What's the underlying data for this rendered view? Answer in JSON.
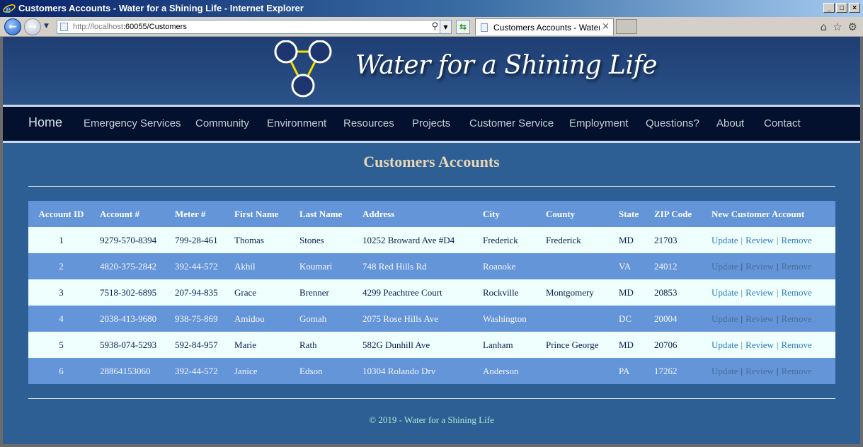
{
  "window": {
    "title": "Customers Accounts - Water for a Shining Life - Internet Explorer",
    "buttons": [
      "_",
      "□",
      "×"
    ]
  },
  "browser": {
    "url_host": "http://localhost",
    "url_rest": ":60055/Customers",
    "tab_label": "Customers Accounts - Water...",
    "tab_close": "×",
    "icons": [
      "back-icon",
      "forward-icon",
      "search-icon",
      "refresh-icon",
      "home-icon",
      "favorites-star-icon",
      "gear-icon"
    ]
  },
  "site": {
    "title": "Water for a Shining Life",
    "logo_colors": {
      "circle": "#1d3670",
      "ring": "#ffffff",
      "triangle": "#f5e000"
    }
  },
  "nav": {
    "items": [
      "Home",
      "Emergency Services",
      "Community",
      "Environment",
      "Resources",
      "Projects",
      "Customer Service",
      "Employment",
      "Questions?",
      "About",
      "Contact"
    ]
  },
  "page": {
    "heading": "Customers Accounts"
  },
  "table": {
    "headers": [
      "Account ID",
      "Account #",
      "Meter #",
      "First Name",
      "Last Name",
      "Address",
      "City",
      "County",
      "State",
      "ZIP Code",
      "New Customer Account"
    ],
    "actions": [
      "Update",
      "Review",
      "Remove"
    ],
    "separator": "|",
    "rows": [
      [
        "1",
        "9279-570-8394",
        "799-28-461",
        "Thomas",
        "Stones",
        "10252 Broward Ave #D4",
        "Frederick",
        "Frederick",
        "MD",
        "21703"
      ],
      [
        "2",
        "4820-375-2842",
        "392-44-572",
        "Akhil",
        "Koumari",
        "748 Red Hills Rd",
        "Roanoke",
        "",
        "VA",
        "24012"
      ],
      [
        "3",
        "7518-302-6895",
        "207-94-835",
        "Grace",
        "Brenner",
        "4299 Peachtree Court",
        "Rockville",
        "Montgomery",
        "MD",
        "20853"
      ],
      [
        "4",
        "2038-413-9680",
        "938-75-869",
        "Amidou",
        "Gomah",
        "2075 Rose Hills Ave",
        "Washington",
        "",
        "DC",
        "20004"
      ],
      [
        "5",
        "5938-074-5293",
        "592-84-957",
        "Marie",
        "Rath",
        "582G Dunhill Ave",
        "Lanham",
        "Prince George",
        "MD",
        "20706"
      ],
      [
        "6",
        "28864153060",
        "392-44-572",
        "Janice",
        "Edson",
        "10304 Rolando Drv",
        "Anderson",
        "",
        "PA",
        "17262"
      ]
    ]
  },
  "footer": {
    "text": "© 2019 - Water for a Shining Life"
  },
  "colors": {
    "header_bg": "#1f3e73",
    "nav_bg": "#03112e",
    "body_bg": "#2d5f95",
    "table_header": "#6495d9",
    "row_light": "#eefffd",
    "heading": "#e8d6b4",
    "footer_text": "#aee6d2"
  }
}
